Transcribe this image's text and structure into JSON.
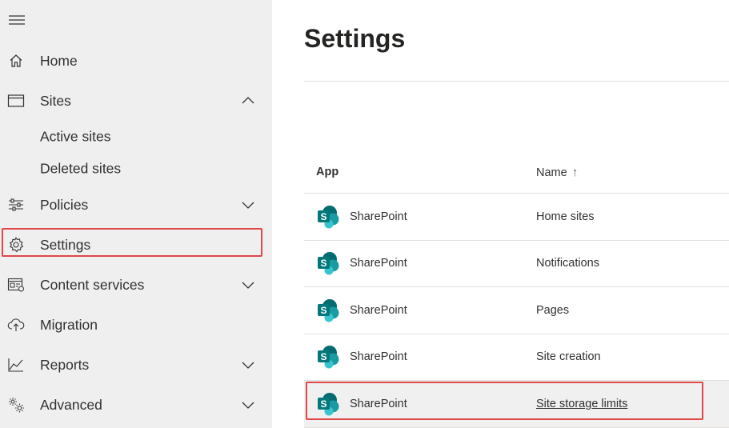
{
  "sidebar": {
    "items": [
      {
        "label": "Home",
        "icon": "home-icon"
      },
      {
        "label": "Sites",
        "icon": "browser-window-icon",
        "expanded": true
      },
      {
        "label": "Policies",
        "icon": "sliders-icon"
      },
      {
        "label": "Settings",
        "icon": "gear-icon",
        "highlighted": true
      },
      {
        "label": "Content services",
        "icon": "content-services-icon"
      },
      {
        "label": "Migration",
        "icon": "cloud-upload-icon"
      },
      {
        "label": "Reports",
        "icon": "chart-line-icon"
      },
      {
        "label": "Advanced",
        "icon": "gears-icon"
      }
    ],
    "sites_subitems": [
      {
        "label": "Active sites"
      },
      {
        "label": "Deleted sites"
      }
    ]
  },
  "main": {
    "title": "Settings",
    "table": {
      "headers": {
        "app": "App",
        "name": "Name",
        "sort": "ascending"
      },
      "rows": [
        {
          "app": "SharePoint",
          "name": "Home sites"
        },
        {
          "app": "SharePoint",
          "name": "Notifications"
        },
        {
          "app": "SharePoint",
          "name": "Pages"
        },
        {
          "app": "SharePoint",
          "name": "Site creation"
        },
        {
          "app": "SharePoint",
          "name": "Site storage limits",
          "highlighted": true
        }
      ]
    }
  },
  "colors": {
    "sidebar_bg": "#efefef",
    "highlight_border": "#e0484a",
    "sharepoint_teal": "#038387",
    "sharepoint_dark": "#0b5a5e"
  }
}
